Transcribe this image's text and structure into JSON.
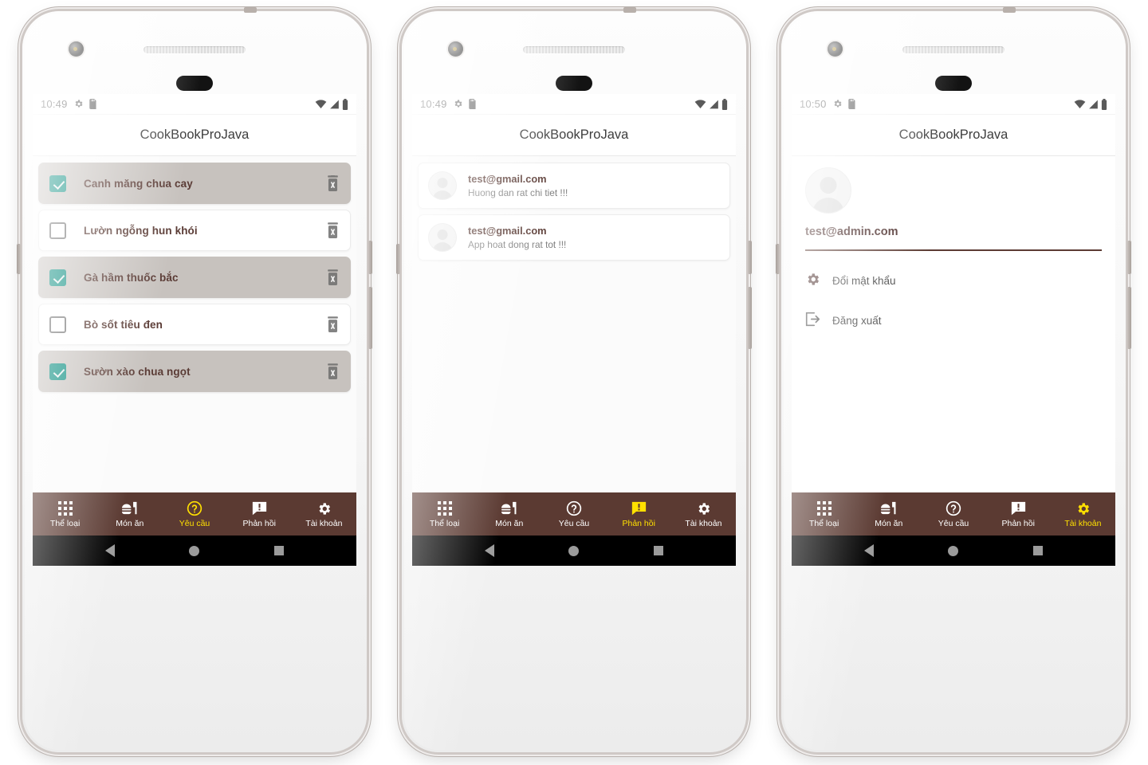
{
  "app": {
    "title": "CookBookProJava",
    "accent_brown": "#5b3a32",
    "accent_yellow": "#ffe000",
    "checkbox_teal": "#00897b",
    "selected_row_bg": "#c7c2be",
    "text_brown": "#5a3b35"
  },
  "nav": {
    "items": [
      {
        "label": "Thể loại",
        "icon": "grid-icon"
      },
      {
        "label": "Món ăn",
        "icon": "burger-icon"
      },
      {
        "label": "Yêu cầu",
        "icon": "question-circle-icon"
      },
      {
        "label": "Phản hồi",
        "icon": "message-alert-icon"
      },
      {
        "label": "Tài khoản",
        "icon": "gear-icon"
      }
    ]
  },
  "phones": [
    {
      "status": {
        "time": "10:49"
      },
      "screen": "requests",
      "active_nav_index": 2,
      "recipes": [
        {
          "name": "Canh măng chua cay",
          "checked": true
        },
        {
          "name": "Lườn ngỗng hun khói",
          "checked": false
        },
        {
          "name": "Gà hầm thuốc bắc",
          "checked": true
        },
        {
          "name": "Bò sốt tiêu đen",
          "checked": false
        },
        {
          "name": "Sườn xào chua ngọt",
          "checked": true
        }
      ]
    },
    {
      "status": {
        "time": "10:49"
      },
      "screen": "feedback",
      "active_nav_index": 3,
      "feedback": [
        {
          "user": "test@gmail.com",
          "message": "Huong dan rat chi tiet !!!"
        },
        {
          "user": "test@gmail.com",
          "message": "App hoat dong rat tot !!!"
        }
      ]
    },
    {
      "status": {
        "time": "10:50"
      },
      "screen": "account",
      "active_nav_index": 4,
      "account": {
        "email": "test@admin.com",
        "items": [
          {
            "label": "Đổi mật khẩu",
            "icon": "gear-icon"
          },
          {
            "label": "Đăng xuất",
            "icon": "logout-icon"
          }
        ]
      }
    }
  ]
}
